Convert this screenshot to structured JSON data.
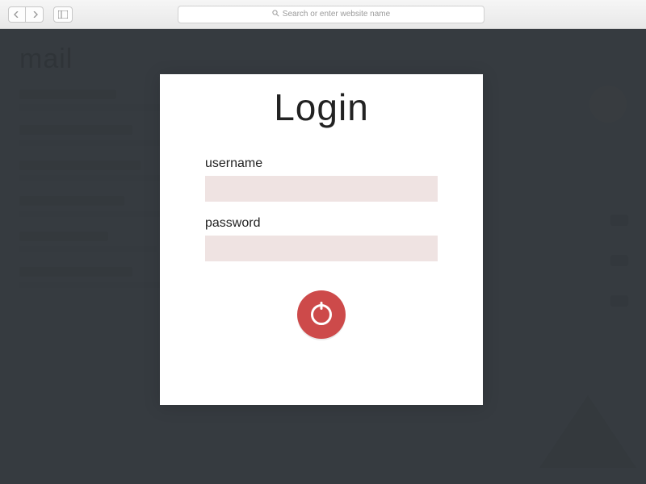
{
  "browser": {
    "url_placeholder": "Search or enter website name"
  },
  "background": {
    "title_hint": "mail"
  },
  "login": {
    "title": "Login",
    "username_label": "username",
    "username_value": "",
    "password_label": "password",
    "password_value": "",
    "submit_icon": "power-icon",
    "accent_color": "#cd4a4a",
    "input_bg": "#efe3e2"
  }
}
